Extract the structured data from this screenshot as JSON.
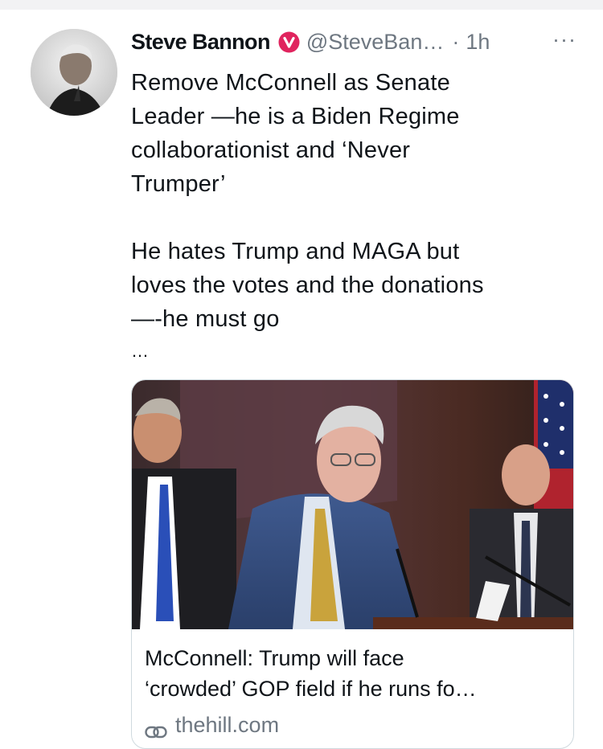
{
  "tweet": {
    "author_name": "Steve Bannon",
    "handle": "@SteveBan…",
    "separator": "·",
    "time": "1h",
    "more_label": "···",
    "paragraph1": "Remove McConnell as Senate\nLeader —he is a Biden Regime\ncollaborationist and ‘Never\nTrumper’",
    "paragraph2": "He hates Trump and MAGA but\nloves the votes and the donations\n—-he must go",
    "ellipsis": "…",
    "icons": {
      "verified": "verified-badge-icon",
      "more": "more-options-icon",
      "link": "link-icon"
    },
    "colors": {
      "badge": "#e0245e",
      "secondary_text": "#6e7781",
      "card_border": "#cfd9de"
    }
  },
  "card": {
    "title_line1": "McConnell: Trump will face",
    "title_line2": "‘crowded’ GOP field if he runs fo…",
    "domain": "thehill.com"
  }
}
